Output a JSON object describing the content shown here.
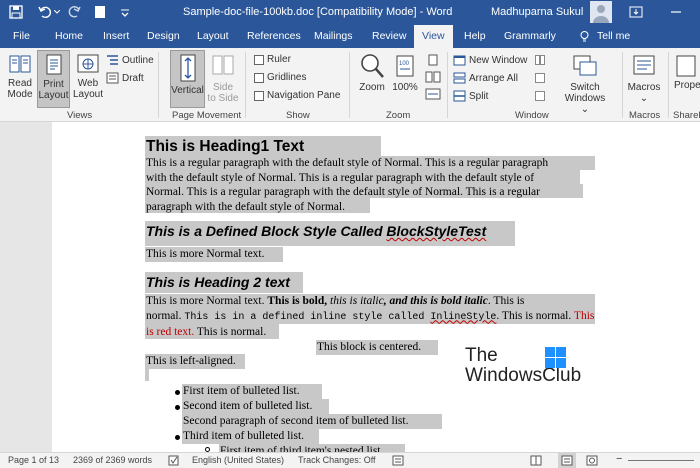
{
  "window": {
    "title": "Sample-doc-file-100kb.doc [Compatibility Mode]  -  Word",
    "user": "Madhuparna Sukul"
  },
  "tabs": [
    "File",
    "Home",
    "Insert",
    "Design",
    "Layout",
    "References",
    "Mailings",
    "Review",
    "View",
    "Help",
    "Grammarly"
  ],
  "tell_me": "Tell me",
  "ribbon": {
    "views": {
      "label": "Views",
      "read_mode": [
        "Read",
        "Mode"
      ],
      "print_layout": [
        "Print",
        "Layout"
      ],
      "web_layout": [
        "Web",
        "Layout"
      ],
      "outline": "Outline",
      "draft": "Draft"
    },
    "page_movement": {
      "label": "Page Movement",
      "vertical": "Vertical",
      "side_to_side": [
        "Side",
        "to Side"
      ]
    },
    "show": {
      "label": "Show",
      "ruler": "Ruler",
      "gridlines": "Gridlines",
      "navigation_pane": "Navigation Pane"
    },
    "zoom": {
      "label": "Zoom",
      "zoom": "Zoom",
      "hundred": "100%"
    },
    "window": {
      "label": "Window",
      "new_window": "New Window",
      "arrange_all": "Arrange All",
      "split": "Split",
      "switch_windows": [
        "Switch",
        "Windows"
      ]
    },
    "macros": {
      "label": "Macros",
      "macros": "Macros"
    },
    "sharepoint": {
      "label": "SharePoi",
      "properties": "Prope"
    }
  },
  "doc": {
    "heading1": "This is Heading1 Text",
    "para1": [
      "This is a regular paragraph with the default style of Normal. This is a regular paragraph",
      "with the default style of Normal. This is a regular paragraph with the default style of",
      "Normal. This is a regular paragraph with the default style of Normal. This is a regular",
      "paragraph with the default style of Normal."
    ],
    "block_heading_pre": "This is a Defined Block Style Called ",
    "block_heading_word": "BlockStyleTest",
    "more_normal": "This is more Normal text.",
    "heading2": "This is Heading 2 text",
    "mixed": {
      "normal": "This is more Normal text. ",
      "bold": "This is bold, ",
      "italic": "this is italic",
      "bold_italic": ", and this is bold italic",
      "normal2": ". This is",
      "normal3": "normal. ",
      "mono_pre": "This is in a defined inline style called ",
      "mono_word": "InlineStyle",
      "normal4": ". This is normal. ",
      "red1": "This",
      "red2": "is red text.",
      "normal5": " This is normal."
    },
    "centered": "This block is centered.",
    "left_aligned": "This is left-aligned.",
    "bullets": [
      "First item of bulleted list.",
      "Second item of bulleted list.",
      "Second paragraph of second item of bulleted list.",
      "Third item of bulleted list.",
      "First item of third item's nested list."
    ]
  },
  "watermark": [
    "The",
    "WindowsClub"
  ],
  "status": {
    "page": "Page 1 of 13",
    "words": "2369 of 2369 words",
    "language": "English (United States)",
    "track_changes": "Track Changes: Off"
  },
  "colors": {
    "brand": "#2b579a",
    "highlight": "#c8c8c8",
    "red_text": "#c00000"
  }
}
